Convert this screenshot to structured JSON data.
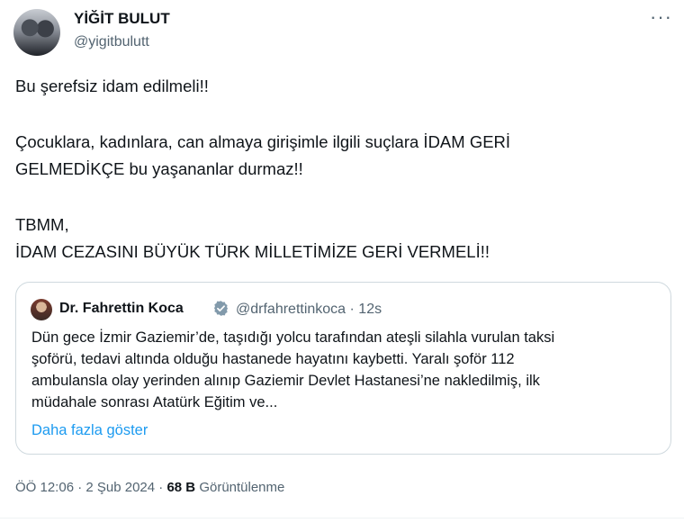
{
  "author": {
    "display_name": "YİĞİT BULUT",
    "handle": "@yigitbulutt"
  },
  "tweet": {
    "lines": [
      "Bu şerefsiz idam edilmeli!!",
      "Çocuklara, kadınlara, can almaya girişimle ilgili suçlara İDAM GERİ",
      "GELMEDİKÇE bu yaşananlar durmaz!!",
      "TBMM,",
      "İDAM CEZASINI BÜYÜK TÜRK MİLLETİMİZE GERİ VERMELİ!!"
    ]
  },
  "quote": {
    "name": "Dr. Fahrettin Koca",
    "handle_time": "@drfahrettinkoca · 12s",
    "lines": [
      "Dün gece İzmir Gaziemir’de, taşıdığı yolcu tarafından ateşli silahla vurulan taksi",
      "şoförü, tedavi altında olduğu hastanede hayatını kaybetti. Yaralı şoför 112",
      "ambulansla olay yerinden alınıp Gaziemir Devlet Hastanesi’ne nakledilmiş, ilk",
      "müdahale sonrası Atatürk Eğitim ve..."
    ],
    "show_more": "Daha fazla göster"
  },
  "meta": {
    "time": "ÖÖ 12:06 · 2 Şub 2024",
    "separator": " · ",
    "views": "68 B",
    "views_label": "Görüntülenme"
  },
  "icons": {
    "more": "more-horizontal-icon",
    "verified": "verified-badge-icon"
  },
  "colors": {
    "link": "#1d9bf0",
    "secondary_text": "#536471",
    "verified": "#829aab"
  }
}
